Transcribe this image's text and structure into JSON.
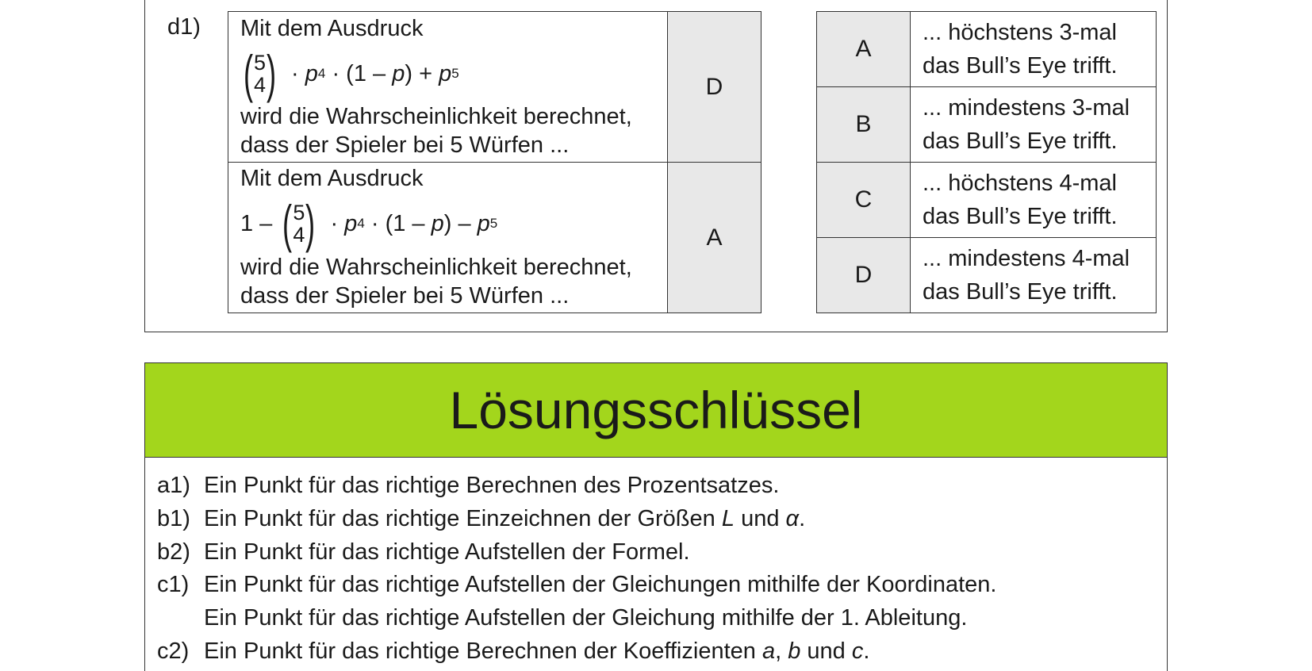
{
  "task": {
    "label": "d1)",
    "left_rows": [
      {
        "line1": "Mit dem Ausdruck",
        "prefix": "",
        "binom_top": "5",
        "binom_bottom": "4",
        "formula_p": "p",
        "formula_exp1": "4",
        "formula_mid": "(1 –",
        "formula_p2": "p",
        "formula_close": ") +",
        "formula_p3": "p",
        "formula_exp2": "5",
        "line3": "wird die Wahrscheinlichkeit berechnet,",
        "line4": "dass der Spieler bei 5 Würfen ...",
        "answer": "D"
      },
      {
        "line1": "Mit dem Ausdruck",
        "prefix": "1 –",
        "binom_top": "5",
        "binom_bottom": "4",
        "formula_p": "p",
        "formula_exp1": "4",
        "formula_mid": "(1 –",
        "formula_p2": "p",
        "formula_close": ") –",
        "formula_p3": "p",
        "formula_exp2": "5",
        "line3": "wird die Wahrscheinlichkeit berechnet,",
        "line4": "dass der Spieler bei 5 Würfen ...",
        "answer": "A"
      }
    ],
    "options": [
      {
        "letter": "A",
        "line1": "... höchstens 3-mal",
        "line2": "das Bull’s Eye trifft."
      },
      {
        "letter": "B",
        "line1": "... mindestens 3-mal",
        "line2": "das Bull’s Eye trifft."
      },
      {
        "letter": "C",
        "line1": "... höchstens 4-mal",
        "line2": "das Bull’s Eye trifft."
      },
      {
        "letter": "D",
        "line1": "... mindestens 4-mal",
        "line2": "das Bull’s Eye trifft."
      }
    ]
  },
  "solution_key": {
    "title": "Lösungsschlüssel",
    "items": [
      {
        "label": "a1)",
        "text": "Ein Punkt für das richtige Berechnen des Prozentsatzes."
      },
      {
        "label": "b1)",
        "text": "Ein Punkt für das richtige Einzeichnen der Größen",
        "v1": "L",
        "mid": "und",
        "v2": "α",
        "end": "."
      },
      {
        "label": "b2)",
        "text": "Ein Punkt für das richtige Aufstellen der Formel."
      },
      {
        "label": "c1)",
        "text": "Ein Punkt für das richtige Aufstellen der Gleichungen mithilfe der Koordinaten."
      },
      {
        "label": "",
        "text": "Ein Punkt für das richtige Aufstellen der Gleichung mithilfe der 1. Ableitung."
      },
      {
        "label": "c2)",
        "text": "Ein Punkt für das richtige Berechnen der Koeffizienten",
        "v1": "a",
        "sep": ",",
        "v2": "b",
        "mid": "und",
        "v3": "c",
        "end": "."
      }
    ]
  }
}
